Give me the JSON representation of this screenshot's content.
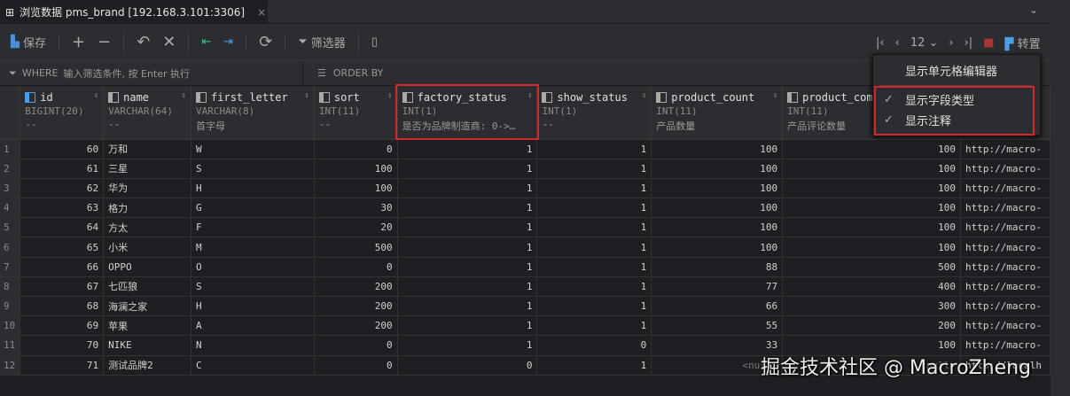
{
  "tab": {
    "title": "浏览数据 pms_brand [192.168.3.101:3306]"
  },
  "toolbar": {
    "save": "保存",
    "filter": "筛选器",
    "page": "12",
    "transpose": "转置"
  },
  "filterbar": {
    "where": "WHERE",
    "where_placeholder": "输入筛选条件, 按 Enter 执行",
    "order": "ORDER BY"
  },
  "menu": {
    "items": [
      {
        "label": "显示单元格编辑器",
        "checked": false
      },
      {
        "label": "显示字段类型",
        "checked": true
      },
      {
        "label": "显示注释",
        "checked": true
      }
    ]
  },
  "columns": [
    {
      "name": "id",
      "type": "BIGINT(20)",
      "comment": "--"
    },
    {
      "name": "name",
      "type": "VARCHAR(64)",
      "comment": "--"
    },
    {
      "name": "first_letter",
      "type": "VARCHAR(8)",
      "comment": "首字母"
    },
    {
      "name": "sort",
      "type": "INT(11)",
      "comment": "--"
    },
    {
      "name": "factory_status",
      "type": "INT(1)",
      "comment": "是否为品牌制造商: 0->…"
    },
    {
      "name": "show_status",
      "type": "INT(1)",
      "comment": "--"
    },
    {
      "name": "product_count",
      "type": "INT(11)",
      "comment": "产品数量"
    },
    {
      "name": "product_comment_count",
      "type": "INT(11)",
      "comment": "产品评论数量"
    },
    {
      "name": "",
      "type": "",
      "comment": ""
    }
  ],
  "rows": [
    [
      "1",
      "60",
      "万和",
      "W",
      "0",
      "1",
      "1",
      "100",
      "100",
      "http://macro-"
    ],
    [
      "2",
      "61",
      "三星",
      "S",
      "100",
      "1",
      "1",
      "100",
      "100",
      "http://macro-"
    ],
    [
      "3",
      "62",
      "华为",
      "H",
      "100",
      "1",
      "1",
      "100",
      "100",
      "http://macro-"
    ],
    [
      "4",
      "63",
      "格力",
      "G",
      "30",
      "1",
      "1",
      "100",
      "100",
      "http://macro-"
    ],
    [
      "5",
      "64",
      "方太",
      "F",
      "20",
      "1",
      "1",
      "100",
      "100",
      "http://macro-"
    ],
    [
      "6",
      "65",
      "小米",
      "M",
      "500",
      "1",
      "1",
      "100",
      "100",
      "http://macro-"
    ],
    [
      "7",
      "66",
      "OPPO",
      "O",
      "0",
      "1",
      "1",
      "88",
      "500",
      "http://macro-"
    ],
    [
      "8",
      "67",
      "七匹狼",
      "S",
      "200",
      "1",
      "1",
      "77",
      "400",
      "http://macro-"
    ],
    [
      "9",
      "68",
      "海澜之家",
      "H",
      "200",
      "1",
      "1",
      "66",
      "300",
      "http://macro-"
    ],
    [
      "10",
      "69",
      "苹果",
      "A",
      "200",
      "1",
      "1",
      "55",
      "200",
      "http://macro-"
    ],
    [
      "11",
      "70",
      "NIKE",
      "N",
      "0",
      "1",
      "0",
      "33",
      "100",
      "http://macro-"
    ],
    [
      "12",
      "71",
      "测试品牌2",
      "C",
      "0",
      "0",
      "1",
      "<null>",
      "<null>",
      "http://localh"
    ]
  ],
  "watermark": "掘金技术社区 @ MacroZheng",
  "colors": {
    "highlight": "#d3272b",
    "background": "#1e1f22",
    "panel": "#2b2d30"
  }
}
